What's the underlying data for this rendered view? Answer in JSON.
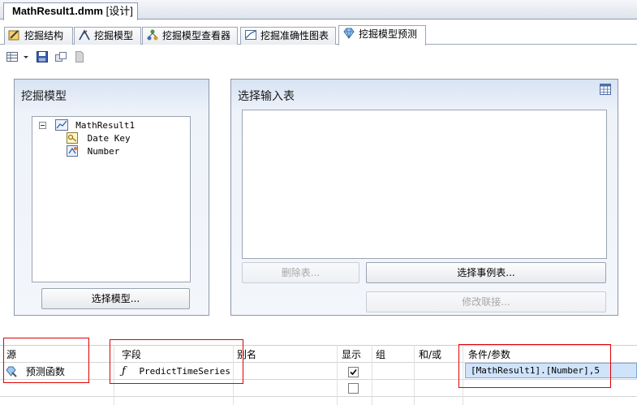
{
  "document": {
    "title": "MathResult1.dmm",
    "mode": "[设计]"
  },
  "tabs": [
    {
      "label": "挖掘结构",
      "icon": "mining-structure-icon"
    },
    {
      "label": "挖掘模型",
      "icon": "mining-model-icon"
    },
    {
      "label": "挖掘模型查看器",
      "icon": "model-viewer-icon"
    },
    {
      "label": "挖掘准确性图表",
      "icon": "accuracy-chart-icon"
    },
    {
      "label": "挖掘模型预测",
      "icon": "model-prediction-icon",
      "active": true
    }
  ],
  "toolbar": {
    "icons": [
      "result-view-icon",
      "dropdown-arrow-icon",
      "save-icon",
      "copy-icon",
      "new-document-icon"
    ]
  },
  "mining_model_panel": {
    "title": "挖掘模型",
    "tree": {
      "root": "MathResult1",
      "children": [
        "Date Key",
        "Number"
      ]
    },
    "select_model_button": "选择模型..."
  },
  "input_table_panel": {
    "title": "选择输入表",
    "delete_table_button": "删除表...",
    "select_case_table_button": "选择事例表...",
    "modify_join_button": "修改联接..."
  },
  "grid": {
    "headers": {
      "source": "源",
      "field": "字段",
      "alias": "别名",
      "show": "显示",
      "group": "组",
      "and_or": "和/或",
      "criteria": "条件/参数"
    },
    "rows": [
      {
        "source": "预测函数",
        "field": "PredictTimeSeries",
        "alias": "",
        "show": true,
        "criteria": "[MathResult1].[Number],5"
      },
      {
        "source": "",
        "field": "",
        "alias": "",
        "show": false,
        "criteria": ""
      }
    ]
  },
  "colors": {
    "highlight_annotation": "#e00000",
    "selected_cell": "#cfe3fb",
    "panel_header": "#d7e3f3"
  }
}
